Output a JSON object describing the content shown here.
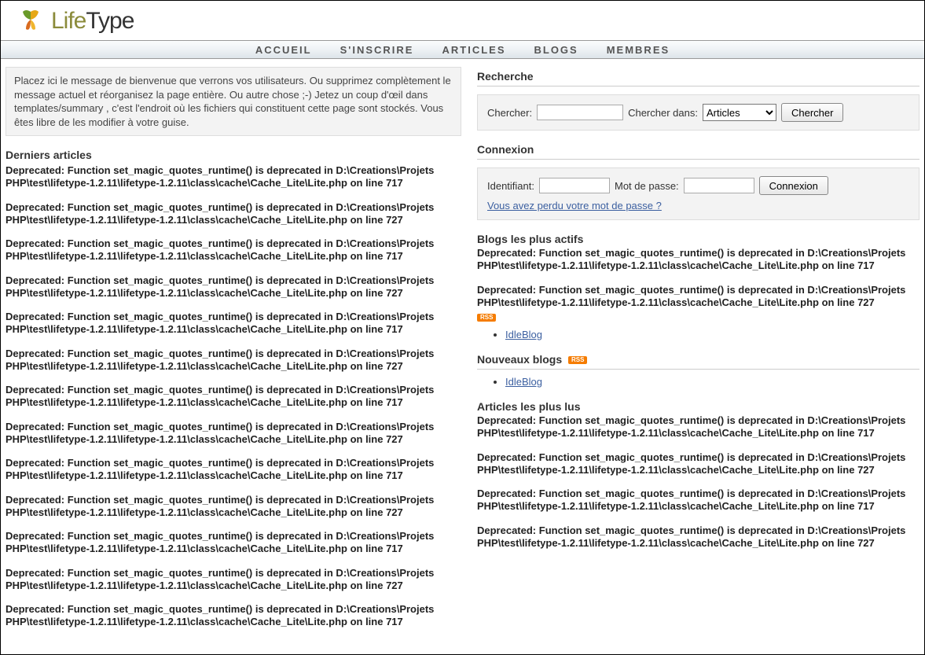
{
  "logo": {
    "life": "Life",
    "type": "Type"
  },
  "nav": {
    "accueil": "ACCUEIL",
    "sinscrire": "S'INSCRIRE",
    "articles": "ARTICLES",
    "blogs": "BLOGS",
    "membres": "MEMBRES"
  },
  "welcome": "Placez ici le message de bienvenue que verrons vos utilisateurs. Ou supprimez complètement le message actuel et réorganisez la page entière. Ou autre chose ;-) Jetez un coup d'œil dans templates/summary , c'est l'endroit où les fichiers qui constituent cette page sont stockés. Vous êtes libre de les modifier à votre guise.",
  "left": {
    "heading": "Derniers articles",
    "err717": "Deprecated: Function set_magic_quotes_runtime() is deprecated in D:\\Creations\\Projets PHP\\test\\lifetype-1.2.11\\lifetype-1.2.11\\class\\cache\\Cache_Lite\\Lite.php on line 717",
    "err727": "Deprecated: Function set_magic_quotes_runtime() is deprecated in D:\\Creations\\Projets PHP\\test\\lifetype-1.2.11\\lifetype-1.2.11\\class\\cache\\Cache_Lite\\Lite.php on line 727"
  },
  "search": {
    "heading": "Recherche",
    "chercher_label": "Chercher:",
    "dans_label": "Chercher dans:",
    "select_value": "Articles",
    "button": "Chercher"
  },
  "login": {
    "heading": "Connexion",
    "id_label": "Identifiant:",
    "pw_label": "Mot de passe:",
    "button": "Connexion",
    "lost": "Vous avez perdu votre mot de passe ?"
  },
  "active_blogs": {
    "heading": "Blogs les plus actifs",
    "err717": "Deprecated: Function set_magic_quotes_runtime() is deprecated in D:\\Creations\\Projets PHP\\test\\lifetype-1.2.11\\lifetype-1.2.11\\class\\cache\\Cache_Lite\\Lite.php on line 717",
    "err727": "Deprecated: Function set_magic_quotes_runtime() is deprecated in D:\\Creations\\Projets PHP\\test\\lifetype-1.2.11\\lifetype-1.2.11\\class\\cache\\Cache_Lite\\Lite.php on line 727",
    "rss": "RSS",
    "item": "IdleBlog"
  },
  "new_blogs": {
    "heading": "Nouveaux blogs",
    "rss": "RSS",
    "item": "IdleBlog"
  },
  "top_articles": {
    "heading": "Articles les plus lus",
    "err717": "Deprecated: Function set_magic_quotes_runtime() is deprecated in D:\\Creations\\Projets PHP\\test\\lifetype-1.2.11\\lifetype-1.2.11\\class\\cache\\Cache_Lite\\Lite.php on line 717",
    "err727": "Deprecated: Function set_magic_quotes_runtime() is deprecated in D:\\Creations\\Projets PHP\\test\\lifetype-1.2.11\\lifetype-1.2.11\\class\\cache\\Cache_Lite\\Lite.php on line 727"
  }
}
